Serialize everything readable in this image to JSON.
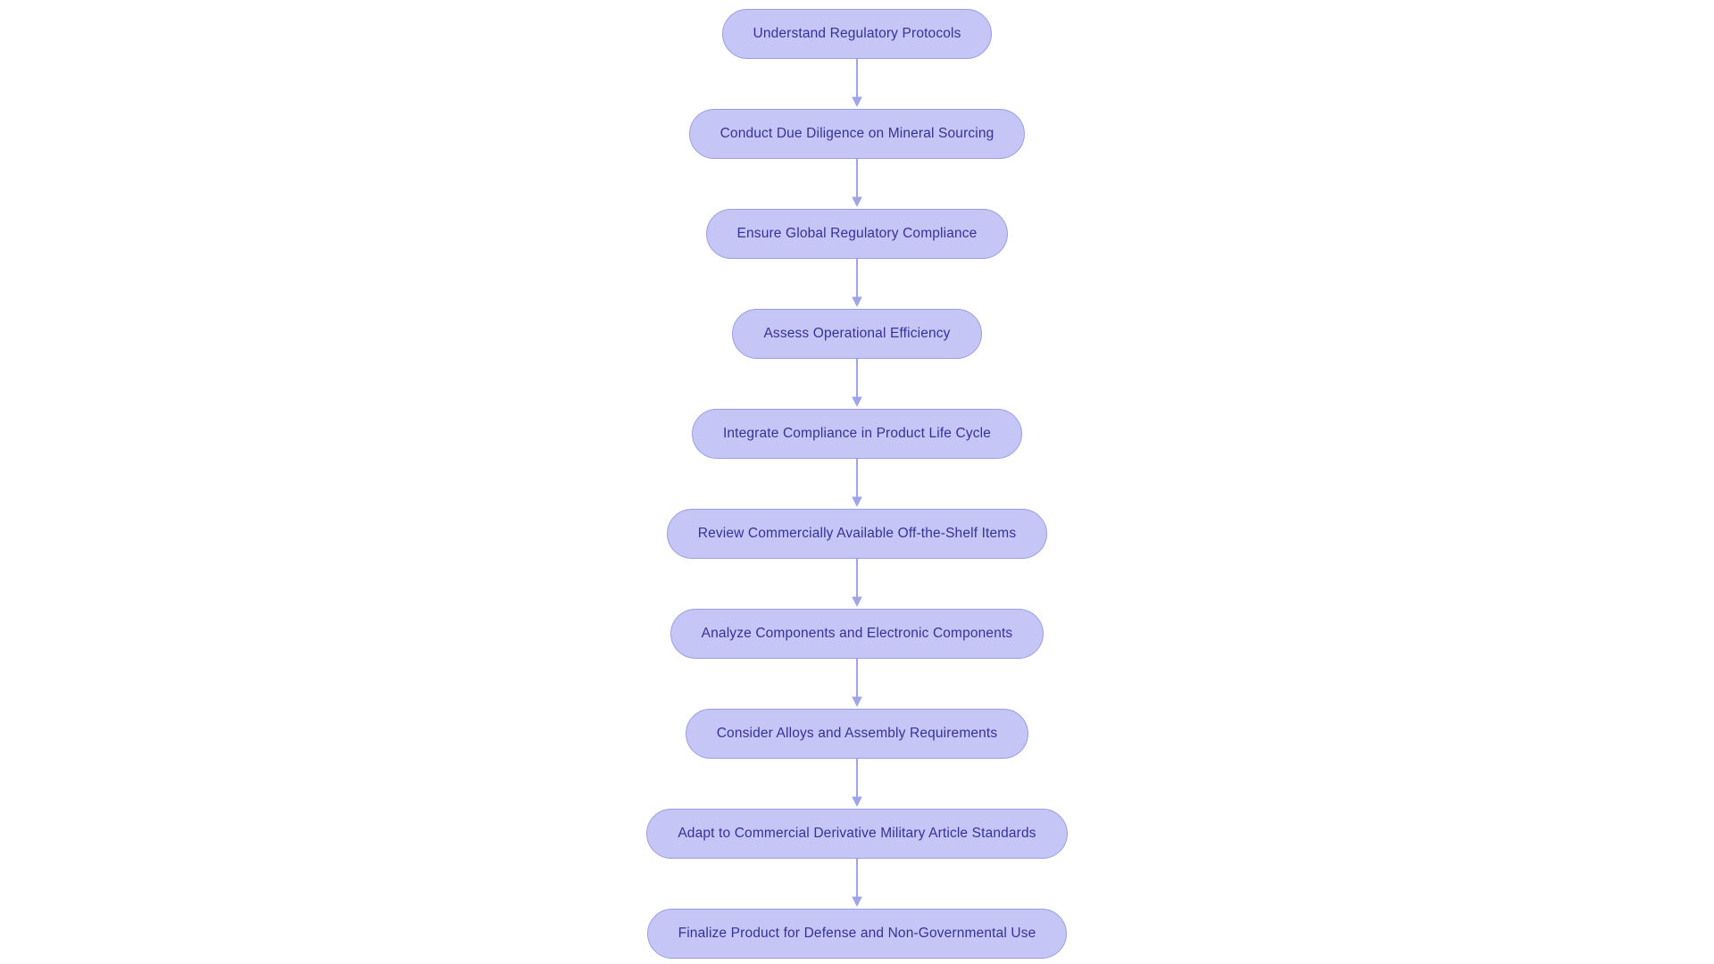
{
  "diagram": {
    "type": "flowchart",
    "orientation": "top-to-bottom",
    "background_color": "#ffffff",
    "node_fill_color": "#c5c6f5",
    "node_border_color": "#9b9ee6",
    "node_text_color": "#333399",
    "connector_color": "#9fa5e8",
    "node_count": 10,
    "connector_count": 9,
    "nodes": [
      {
        "id": "n1",
        "label": "Understand Regulatory Protocols"
      },
      {
        "id": "n2",
        "label": "Conduct Due Diligence on Mineral Sourcing"
      },
      {
        "id": "n3",
        "label": "Ensure Global Regulatory Compliance"
      },
      {
        "id": "n4",
        "label": "Assess Operational Efficiency"
      },
      {
        "id": "n5",
        "label": "Integrate Compliance in Product Life Cycle"
      },
      {
        "id": "n6",
        "label": "Review Commercially Available Off-the-Shelf Items"
      },
      {
        "id": "n7",
        "label": "Analyze Components and Electronic Components"
      },
      {
        "id": "n8",
        "label": "Consider Alloys and Assembly Requirements"
      },
      {
        "id": "n9",
        "label": "Adapt to Commercial Derivative Military Article Standards"
      },
      {
        "id": "n10",
        "label": "Finalize Product for Defense and Non-Governmental Use"
      }
    ],
    "edges": [
      {
        "from": "n1",
        "to": "n2",
        "arrow": "down-arrow-icon"
      },
      {
        "from": "n2",
        "to": "n3",
        "arrow": "down-arrow-icon"
      },
      {
        "from": "n3",
        "to": "n4",
        "arrow": "down-arrow-icon"
      },
      {
        "from": "n4",
        "to": "n5",
        "arrow": "down-arrow-icon"
      },
      {
        "from": "n5",
        "to": "n6",
        "arrow": "down-arrow-icon"
      },
      {
        "from": "n6",
        "to": "n7",
        "arrow": "down-arrow-icon"
      },
      {
        "from": "n7",
        "to": "n8",
        "arrow": "down-arrow-icon"
      },
      {
        "from": "n8",
        "to": "n9",
        "arrow": "down-arrow-icon"
      },
      {
        "from": "n9",
        "to": "n10",
        "arrow": "down-arrow-icon"
      }
    ]
  }
}
